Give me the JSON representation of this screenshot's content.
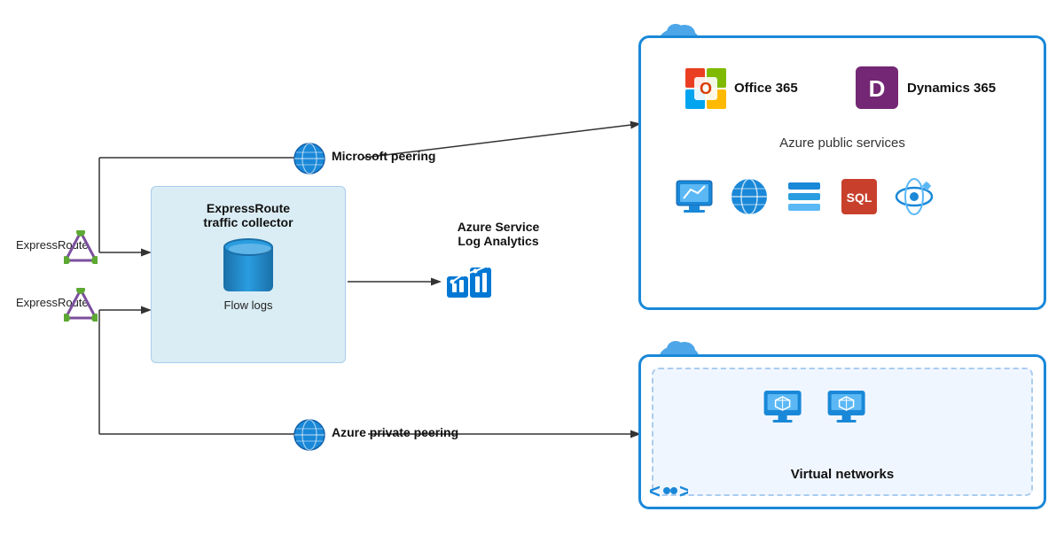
{
  "labels": {
    "expressroute1": "ExpressRoute",
    "expressroute2": "ExpressRoute",
    "collector_title": "ExpressRoute\ntraffic collector",
    "flow_logs": "Flow logs",
    "log_analytics_title": "Azure Service\nLog Analytics",
    "microsoft_peering": "Microsoft peering",
    "azure_private_peering": "Azure private peering",
    "azure_public_services": "Azure public services",
    "office365": "Office 365",
    "dynamics365": "Dynamics 365",
    "virtual_networks": "Virtual networks"
  },
  "colors": {
    "blue_border": "#1a88d8",
    "light_blue_bg": "#e8f4fb",
    "arrow_color": "#333",
    "globe_blue": "#1a88d8",
    "triangle_purple": "#7B4F9E",
    "triangle_green_dot": "#5ca833"
  }
}
